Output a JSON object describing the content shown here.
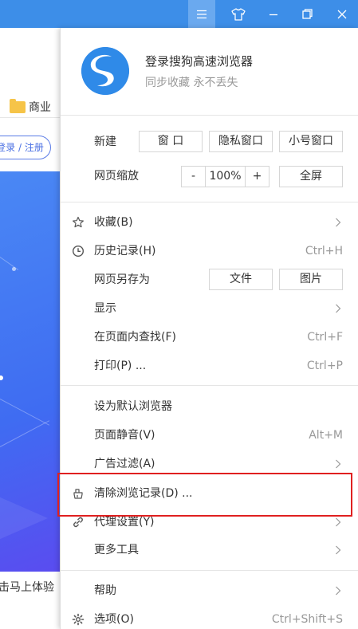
{
  "titlebar": {
    "buttons": [
      {
        "name": "menu-icon"
      },
      {
        "name": "skin-icon"
      },
      {
        "name": "minimize-icon"
      },
      {
        "name": "restore-icon"
      },
      {
        "name": "close-icon"
      }
    ],
    "accent": "#3d8ee8"
  },
  "background_page": {
    "bookmark_label": "商业",
    "login_label": "登录 / 注册",
    "caption": "击马上体验"
  },
  "menu": {
    "header": {
      "title": "登录搜狗高速浏览器",
      "subtitle": "同步收藏 永不丢失"
    },
    "new_row": {
      "label": "新建",
      "window": "窗 口",
      "private": "隐私窗口",
      "small": "小号窗口"
    },
    "zoom_row": {
      "label": "网页缩放",
      "minus": "-",
      "value": "100%",
      "plus": "+",
      "fullscreen": "全屏"
    },
    "favorites": {
      "label": "收藏(B)"
    },
    "history": {
      "label": "历史记录(H)",
      "shortcut": "Ctrl+H"
    },
    "save_as": {
      "label": "网页另存为",
      "file": "文件",
      "image": "图片"
    },
    "display": {
      "label": "显示"
    },
    "find": {
      "label": "在页面内查找(F)",
      "shortcut": "Ctrl+F"
    },
    "print": {
      "label": "打印(P) ...",
      "shortcut": "Ctrl+P"
    },
    "default_browser": {
      "label": "设为默认浏览器"
    },
    "mute": {
      "label": "页面静音(V)",
      "shortcut": "Alt+M"
    },
    "adfilter": {
      "label": "广告过滤(A)"
    },
    "clear_history": {
      "label": "清除浏览记录(D) ..."
    },
    "proxy": {
      "label": "代理设置(Y)"
    },
    "more_tools": {
      "label": "更多工具"
    },
    "help": {
      "label": "帮助"
    },
    "options": {
      "label": "选项(O)",
      "shortcut": "Ctrl+Shift+S"
    }
  },
  "highlight_color": "#e02020"
}
